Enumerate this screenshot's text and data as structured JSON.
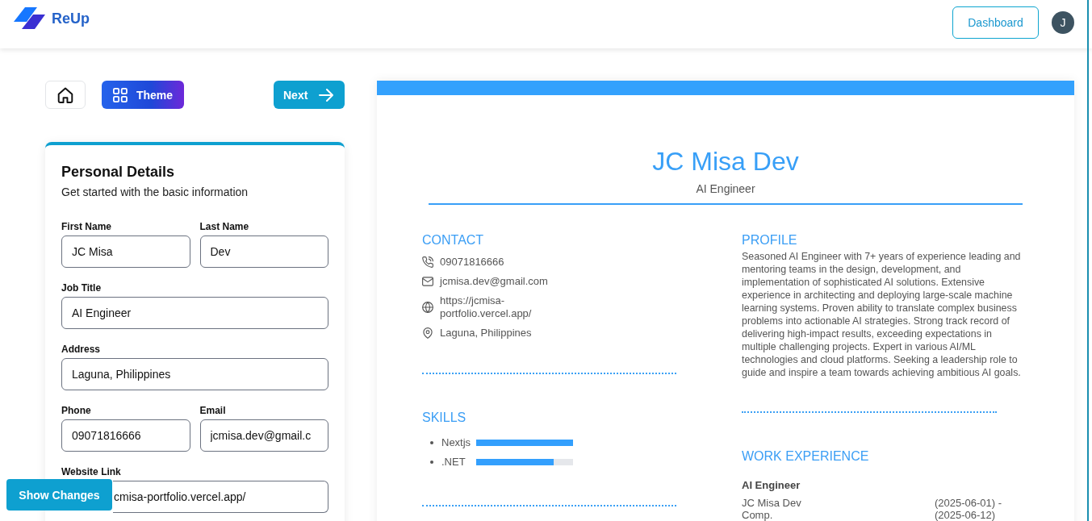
{
  "header": {
    "logo_text": "ReUp",
    "dashboard_button": "Dashboard",
    "avatar_initial": "J"
  },
  "toolbar": {
    "theme_button": "Theme",
    "next_button": "Next"
  },
  "form": {
    "title": "Personal Details",
    "subtitle": "Get started with the basic information",
    "rows": [
      {
        "fields": [
          {
            "label": "First Name",
            "value": "JC Misa"
          },
          {
            "label": "Last Name",
            "value": "Dev"
          }
        ]
      },
      {
        "fields": [
          {
            "label": "Job Title",
            "value": "AI Engineer"
          }
        ]
      },
      {
        "fields": [
          {
            "label": "Address",
            "value": "Laguna, Philippines"
          }
        ]
      },
      {
        "fields": [
          {
            "label": "Phone",
            "value": "09071816666"
          },
          {
            "label": "Email",
            "value": "jcmisa.dev@gmail.c"
          }
        ]
      },
      {
        "fields": [
          {
            "label": "Website Link",
            "value": "cmisa-portfolio.vercel.app/"
          }
        ]
      }
    ]
  },
  "show_changes_button": "Show Changes",
  "resume": {
    "name": "JC Misa Dev",
    "job_title": "AI Engineer",
    "contact": {
      "heading": "CONTACT",
      "items": [
        {
          "kind": "phone",
          "text": "09071816666"
        },
        {
          "kind": "email",
          "text": "jcmisa.dev@gmail.com"
        },
        {
          "kind": "website",
          "text": "https://jcmisa-portfolio.vercel.app/"
        },
        {
          "kind": "location",
          "text": "Laguna, Philippines"
        }
      ]
    },
    "skills": {
      "heading": "SKILLS",
      "items": [
        {
          "name": "Nextjs",
          "level": 1
        },
        {
          "name": ".NET",
          "level": 0.8
        }
      ]
    },
    "profile": {
      "heading": "PROFILE",
      "text": "Seasoned AI Engineer with 7+ years of experience leading and mentoring teams in the design, development, and implementation of sophisticated AI solutions. Extensive experience in architecting and deploying large-scale machine learning systems. Proven ability to translate complex business problems into actionable AI strategies. Strong track record of delivering high-impact results, exceeding expectations in multiple challenging projects. Expert in various AI/ML technologies and cloud platforms. Seeking a leadership role to guide and inspire a team towards achieving ambitious AI goals."
    },
    "work_experience": {
      "heading": "WORK EXPERIENCE",
      "items": [
        {
          "role": "AI Engineer",
          "company": "JC Misa Dev Comp.",
          "dates": "(2025-06-01) - (2025-06-12)"
        }
      ]
    }
  }
}
